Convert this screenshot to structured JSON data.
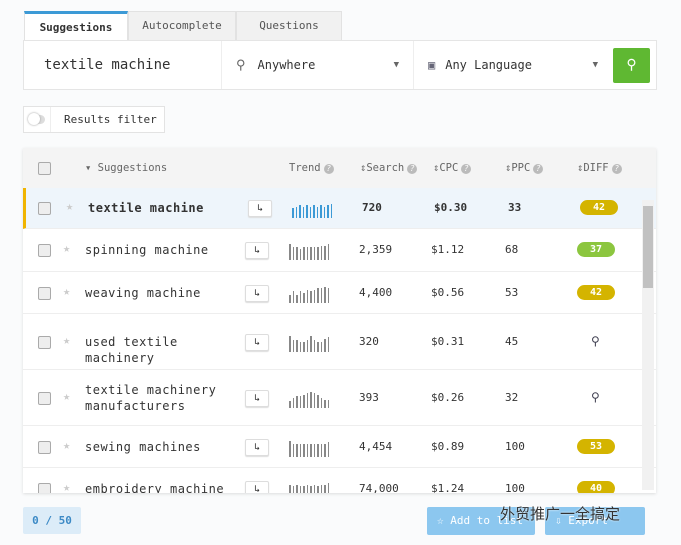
{
  "tabs": [
    {
      "label": "Suggestions",
      "active": true
    },
    {
      "label": "Autocomplete"
    },
    {
      "label": "Questions"
    }
  ],
  "search": {
    "keyword": "textile machine",
    "location": "Anywhere",
    "language": "Any Language",
    "location_icon": "map-pin-icon",
    "language_icon": "translate-icon",
    "search_icon": "search-icon"
  },
  "filter": {
    "label": "Results filter",
    "enabled": false
  },
  "table": {
    "headers": {
      "suggestions": "Suggestions",
      "trend": "Trend",
      "search": "Search",
      "cpc": "CPC",
      "ppc": "PPC",
      "diff": "DIFF"
    },
    "rows": [
      {
        "keyword": "textile machine",
        "search": "720",
        "cpc": "$0.30",
        "ppc": "33",
        "diff": "42",
        "diff_color": "#d4b400",
        "selected": true,
        "trend": [
          0.6,
          0.7,
          0.8,
          0.7,
          0.8,
          0.7,
          0.8,
          0.7,
          0.8,
          0.7,
          0.8,
          0.9
        ]
      },
      {
        "keyword": "spinning machine",
        "search": "2,359",
        "cpc": "$1.12",
        "ppc": "68",
        "diff": "37",
        "diff_color": "#8cc63f",
        "trend": [
          1,
          0.8,
          0.8,
          0.7,
          0.8,
          0.8,
          0.8,
          0.8,
          0.8,
          0.9,
          0.9,
          1
        ]
      },
      {
        "keyword": "weaving machine",
        "search": "4,400",
        "cpc": "$0.56",
        "ppc": "53",
        "diff": "42",
        "diff_color": "#d4b400",
        "trend": [
          0.5,
          0.7,
          0.5,
          0.7,
          0.6,
          0.8,
          0.7,
          0.8,
          0.9,
          0.9,
          1,
          0.9
        ]
      },
      {
        "keyword": "used textile machinery",
        "search": "320",
        "cpc": "$0.31",
        "ppc": "45",
        "diff": null,
        "trend": [
          1,
          0.7,
          0.7,
          0.6,
          0.6,
          0.7,
          1,
          0.7,
          0.6,
          0.6,
          0.8,
          0.9
        ]
      },
      {
        "keyword": "textile machinery manufacturers",
        "search": "393",
        "cpc": "$0.26",
        "ppc": "32",
        "diff": null,
        "trend": [
          0.4,
          0.6,
          0.7,
          0.7,
          0.8,
          0.9,
          1,
          0.9,
          0.8,
          0.6,
          0.5,
          0.5
        ]
      },
      {
        "keyword": "sewing machines",
        "search": "4,454",
        "cpc": "$0.89",
        "ppc": "100",
        "diff": "53",
        "diff_color": "#d4b400",
        "trend": [
          1,
          0.8,
          0.8,
          0.8,
          0.8,
          0.8,
          0.8,
          0.8,
          0.8,
          0.8,
          0.8,
          0.9
        ]
      },
      {
        "keyword": "embroidery machine",
        "search": "74,000",
        "cpc": "$1.24",
        "ppc": "100",
        "diff": "40",
        "diff_color": "#d4b400",
        "trend": [
          0.9,
          0.8,
          0.9,
          0.8,
          0.8,
          0.9,
          0.8,
          0.9,
          0.8,
          0.9,
          0.9,
          1
        ]
      }
    ]
  },
  "footer": {
    "count": "0 / 50",
    "add_to_list": "Add to list",
    "export": "Export",
    "watermark": "外贸推广一全搞定"
  }
}
